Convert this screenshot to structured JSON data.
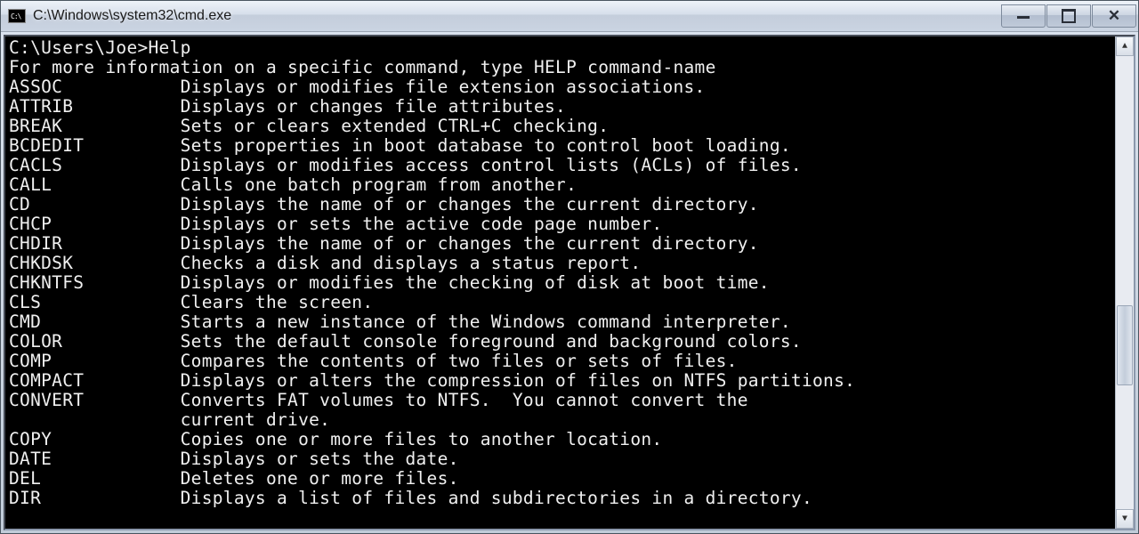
{
  "window": {
    "title": "C:\\Windows\\system32\\cmd.exe"
  },
  "console": {
    "prompt": "C:\\Users\\Joe>",
    "command": "Help",
    "header": "For more information on a specific command, type HELP command-name",
    "commands": [
      {
        "name": "ASSOC",
        "desc": "Displays or modifies file extension associations."
      },
      {
        "name": "ATTRIB",
        "desc": "Displays or changes file attributes."
      },
      {
        "name": "BREAK",
        "desc": "Sets or clears extended CTRL+C checking."
      },
      {
        "name": "BCDEDIT",
        "desc": "Sets properties in boot database to control boot loading."
      },
      {
        "name": "CACLS",
        "desc": "Displays or modifies access control lists (ACLs) of files."
      },
      {
        "name": "CALL",
        "desc": "Calls one batch program from another."
      },
      {
        "name": "CD",
        "desc": "Displays the name of or changes the current directory."
      },
      {
        "name": "CHCP",
        "desc": "Displays or sets the active code page number."
      },
      {
        "name": "CHDIR",
        "desc": "Displays the name of or changes the current directory."
      },
      {
        "name": "CHKDSK",
        "desc": "Checks a disk and displays a status report."
      },
      {
        "name": "CHKNTFS",
        "desc": "Displays or modifies the checking of disk at boot time."
      },
      {
        "name": "CLS",
        "desc": "Clears the screen."
      },
      {
        "name": "CMD",
        "desc": "Starts a new instance of the Windows command interpreter."
      },
      {
        "name": "COLOR",
        "desc": "Sets the default console foreground and background colors."
      },
      {
        "name": "COMP",
        "desc": "Compares the contents of two files or sets of files."
      },
      {
        "name": "COMPACT",
        "desc": "Displays or alters the compression of files on NTFS partitions."
      },
      {
        "name": "CONVERT",
        "desc": "Converts FAT volumes to NTFS.  You cannot convert the"
      },
      {
        "name": "",
        "desc": "current drive."
      },
      {
        "name": "COPY",
        "desc": "Copies one or more files to another location."
      },
      {
        "name": "DATE",
        "desc": "Displays or sets the date."
      },
      {
        "name": "DEL",
        "desc": "Deletes one or more files."
      },
      {
        "name": "DIR",
        "desc": "Displays a list of files and subdirectories in a directory."
      }
    ]
  }
}
